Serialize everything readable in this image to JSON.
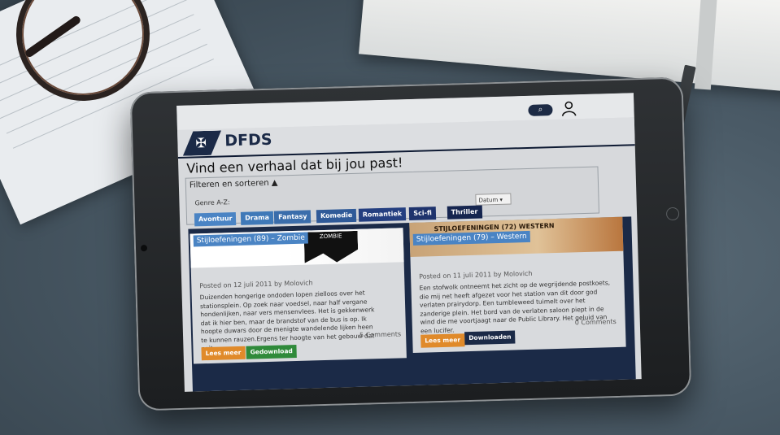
{
  "app": {
    "brand": "DFDS"
  },
  "header": {
    "headline": "Vind een verhaal dat bij jou past!"
  },
  "filter": {
    "title": "Filteren en sorteren ▲",
    "genre_label": "Genre A-Z:",
    "genres": [
      {
        "label": "Avontuur",
        "color": "#4a84c4"
      },
      {
        "label": "Drama",
        "color": "#3f79b8"
      },
      {
        "label": "Fantasy",
        "color": "#3a6dab"
      },
      {
        "label": "Komedie",
        "color": "#2f5a98"
      },
      {
        "label": "Romantiek",
        "color": "#243f80"
      },
      {
        "label": "Sci-fi",
        "color": "#1e336d"
      },
      {
        "label": "Thriller",
        "color": "#15254f"
      }
    ],
    "sort_value": "Datum ▾"
  },
  "cards": [
    {
      "tag": "Stijloefeningen (89) – Zombie",
      "image_text": "ZOMBIE",
      "meta": "Posted on 12 juli 2011 by Molovich",
      "excerpt": "Duizenden hongerige ondoden lopen zielloos over het stationsplein. Op zoek naar voedsel, naar half vergane hondenlijken, naar vers mensenvlees. Het is gekkenwerk dat ik hier ben, maar de brandstof van de bus is op. Ik hoopte duwars door de menigte wandelende lijken heen te kunnen rauzen.Ergens ter hoogte van het gebouw dat ooit",
      "comments": "5 Comments",
      "read_label": "Lees meer",
      "download_label": "Gedownload"
    },
    {
      "tag": "Stijloefeningen (79) – Western",
      "image_text": "STIJLOEFENINGEN (72) WESTERN",
      "meta": "Posted on 11 juli 2011 by Molovich",
      "excerpt": "Een stofwolk ontneemt het zicht op de wegrijdende postkoets, die mij net heeft afgezet voor het station van dit door god verlaten prairydorp. Een tumbleweed tuimelt over het zanderige plein. Het bord van de verlaten saloon piept in de wind die me voortjaagt naar de Public Library. Het geluid van een lucifer.",
      "comments": "0 Comments",
      "read_label": "Lees meer",
      "download_label": "Downloaden"
    }
  ],
  "icons": {
    "search": "search-icon",
    "user": "user-icon"
  },
  "colors": {
    "navy": "#1b2a47",
    "orange": "#e08a2a",
    "green": "#2f8a3a"
  }
}
